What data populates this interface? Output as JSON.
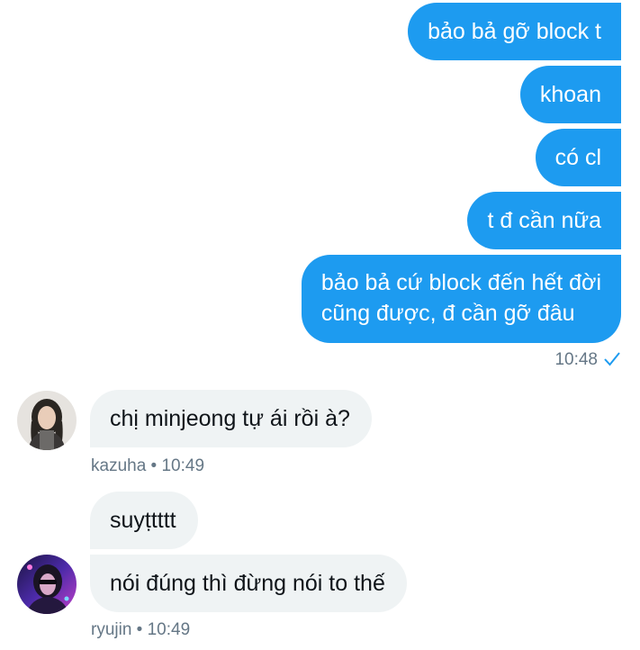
{
  "sent": {
    "messages": [
      "bảo bả gỡ block t",
      "khoan",
      "có cl",
      "t đ cần nữa",
      "bảo bả cứ block đến hết đời\ncũng được, đ cần gỡ đâu"
    ],
    "timestamp": "10:48",
    "status_icon": "check-icon"
  },
  "kazuha": {
    "message": "chị minjeong tự ái rồi à?",
    "meta": "kazuha • 10:49",
    "avatar": "avatar-kazuha"
  },
  "ryujin": {
    "messages": [
      "suyṭtttt",
      "nói đúng thì đừng nói to thế"
    ],
    "meta": "ryujin • 10:49",
    "avatar": "avatar-ryujin"
  },
  "colors": {
    "sent_bubble": "#1d9bf0",
    "received_bubble": "#eff3f4",
    "meta_text": "#657786",
    "read_check": "#1d9bf0"
  }
}
